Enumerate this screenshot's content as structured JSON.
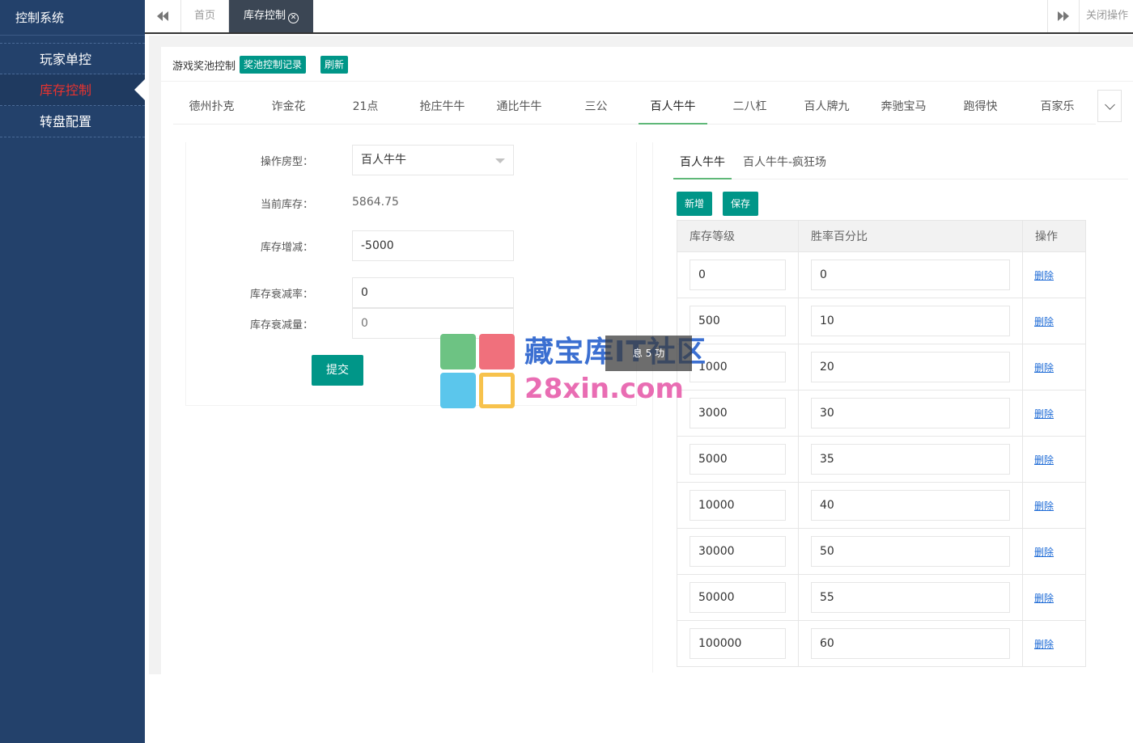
{
  "app": {
    "title": "控制系统"
  },
  "sidebar": {
    "items": [
      {
        "label": "玩家单控"
      },
      {
        "label": "库存控制"
      },
      {
        "label": "转盘配置"
      }
    ]
  },
  "topbar": {
    "home_tab": "首页",
    "active_tab": "库存控制",
    "close_ops": "关闭操作"
  },
  "header": {
    "title": "游戏奖池控制",
    "record_button": "奖池控制记录",
    "refresh_button": "刷新"
  },
  "game_tabs": [
    "德州扑克",
    "诈金花",
    "21点",
    "抢庄牛牛",
    "通比牛牛",
    "三公",
    "百人牛牛",
    "二八杠",
    "百人牌九",
    "奔驰宝马",
    "跑得快",
    "百家乐"
  ],
  "form": {
    "room_type_label": "操作房型：",
    "room_type_value": "百人牛牛",
    "current_stock_label": "当前库存：",
    "current_stock_value": "5864.75",
    "stock_change_label": "库存增减：",
    "stock_change_value": "-5000",
    "decay_rate_label": "库存衰减率：",
    "decay_rate_value": "0",
    "decay_amount_label": "库存衰减量：",
    "decay_amount_placeholder": "0",
    "submit_label": "提交"
  },
  "right_panel": {
    "sub_tabs": [
      "百人牛牛",
      "百人牛牛-疯狂场"
    ],
    "add_button": "新增",
    "save_button": "保存",
    "table": {
      "headers": [
        "库存等级",
        "胜率百分比",
        "操作"
      ],
      "delete_label": "删除",
      "rows": [
        {
          "level": "0",
          "rate": "0"
        },
        {
          "level": "500",
          "rate": "10"
        },
        {
          "level": "1000",
          "rate": "20"
        },
        {
          "level": "3000",
          "rate": "30"
        },
        {
          "level": "5000",
          "rate": "35"
        },
        {
          "level": "10000",
          "rate": "40"
        },
        {
          "level": "30000",
          "rate": "50"
        },
        {
          "level": "50000",
          "rate": "55"
        },
        {
          "level": "100000",
          "rate": "60"
        }
      ]
    }
  },
  "watermark": {
    "line1": "藏宝库IT社区",
    "line2": "28xin.com",
    "overlay_text": "息 5 功"
  },
  "colors": {
    "sidebar_bg": "#23416b",
    "accent": "#009688",
    "active_menu": "#e8332f",
    "tab_underline": "#5fb878",
    "link": "#1e6bd6"
  }
}
